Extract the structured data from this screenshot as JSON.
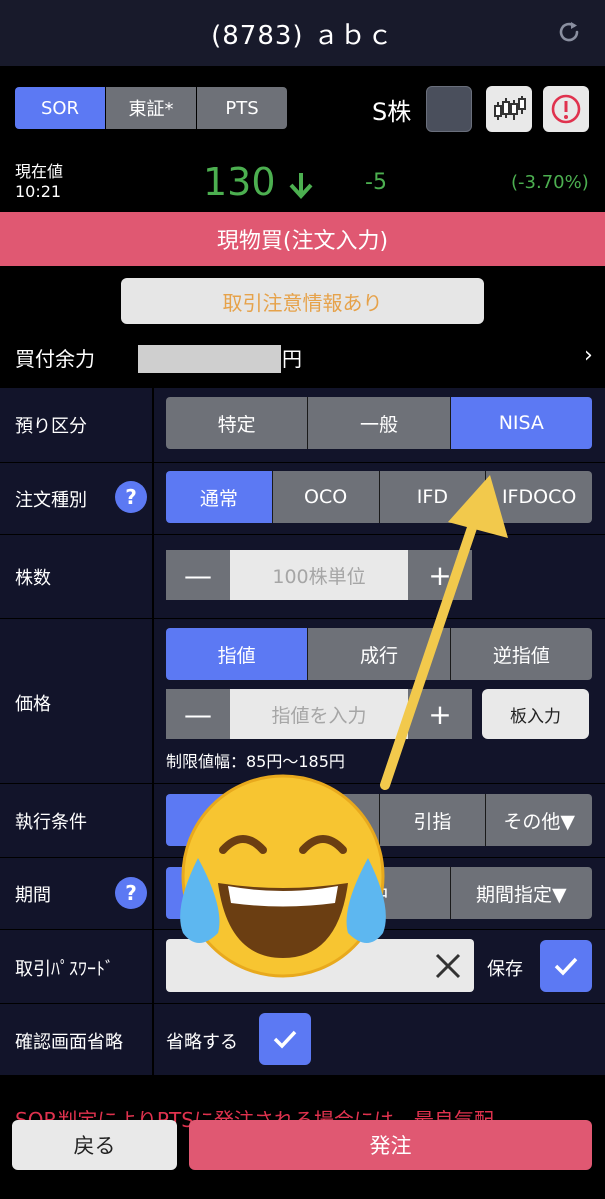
{
  "header": {
    "title": "(8783) ａｂｃ",
    "refresh_icon": "refresh-icon"
  },
  "market": {
    "segments": [
      "SOR",
      "東証*",
      "PTS"
    ],
    "selected": "SOR",
    "skabu_label": "S株",
    "chart_icon": "candlestick-icon",
    "info_icon": "info-icon"
  },
  "quote": {
    "label": "現在値",
    "time": "10:21",
    "price": "130",
    "direction_icon": "down-arrow-icon",
    "change": "-5",
    "change_pct": "(-3.70%)",
    "color": "#4caf50"
  },
  "order_banner": "現物買(注文入力)",
  "caution_button": "取引注意情報あり",
  "buying_power": {
    "label": "買付余力",
    "unit": "円",
    "chevron": "›"
  },
  "form": {
    "account": {
      "label": "預り区分",
      "options": [
        "特定",
        "一般",
        "NISA"
      ],
      "selected": "NISA"
    },
    "order_type": {
      "label": "注文種別",
      "help": "?",
      "options": [
        "通常",
        "OCO",
        "IFD",
        "IFDOCO"
      ],
      "selected": "通常"
    },
    "quantity": {
      "label": "株数",
      "placeholder": "100株単位",
      "minus": "—",
      "plus": "+"
    },
    "price": {
      "label": "価格",
      "options": [
        "指値",
        "成行",
        "逆指値"
      ],
      "selected": "指値",
      "placeholder": "指値を入力",
      "minus": "—",
      "plus": "+",
      "board_button": "板入力",
      "limit_text": "制限値幅：85円〜185円"
    },
    "execution": {
      "label": "執行条件",
      "options": [
        "",
        "",
        "引指",
        "その他▼"
      ]
    },
    "period": {
      "label": "期間",
      "help": "?",
      "options": [
        "",
        "中",
        "期間指定▼"
      ]
    },
    "password": {
      "label": "取引ﾊﾟｽﾜｰﾄﾞ",
      "clear_icon": "clear-x-icon",
      "save_label": "保存",
      "save_checked": true
    },
    "skip_confirm": {
      "label": "確認画面省略",
      "text": "省略する",
      "checked": true
    }
  },
  "notice": "SOR判定によりPTSに発注される場合には、最良気配",
  "footer": {
    "back": "戻る",
    "order": "発注"
  },
  "overlay": {
    "emoji": "😂",
    "arrow_color": "#f2c94c"
  },
  "colors": {
    "accent": "#5c79f3",
    "order_red": "#e05872",
    "up_down_green": "#4caf50"
  }
}
